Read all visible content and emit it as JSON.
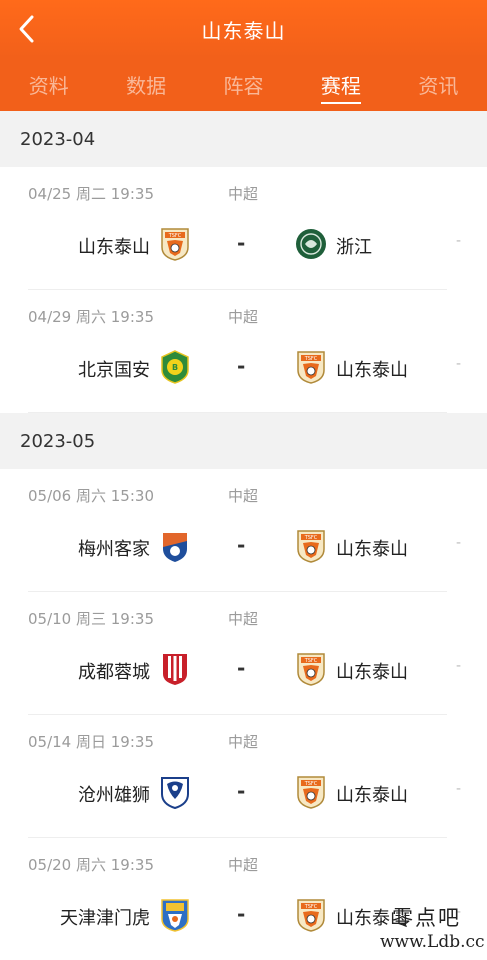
{
  "header": {
    "title": "山东泰山"
  },
  "tabs": [
    {
      "label": "资料",
      "active": false
    },
    {
      "label": "数据",
      "active": false
    },
    {
      "label": "阵容",
      "active": false
    },
    {
      "label": "赛程",
      "active": true
    },
    {
      "label": "资讯",
      "active": false
    }
  ],
  "months": [
    {
      "label": "2023-04",
      "matches": [
        {
          "date": "04/25 周二 19:35",
          "league": "中超",
          "home": "山东泰山",
          "home_logo": "taishan-crest-icon",
          "score": "-",
          "away": "浙江",
          "away_logo": "zhejiang-crest-icon",
          "trail": "-"
        },
        {
          "date": "04/29 周六 19:35",
          "league": "中超",
          "home": "北京国安",
          "home_logo": "guoan-crest-icon",
          "score": "-",
          "away": "山东泰山",
          "away_logo": "taishan-crest-icon",
          "trail": "-"
        }
      ]
    },
    {
      "label": "2023-05",
      "matches": [
        {
          "date": "05/06 周六 15:30",
          "league": "中超",
          "home": "梅州客家",
          "home_logo": "meizhou-crest-icon",
          "score": "-",
          "away": "山东泰山",
          "away_logo": "taishan-crest-icon",
          "trail": "-"
        },
        {
          "date": "05/10 周三 19:35",
          "league": "中超",
          "home": "成都蓉城",
          "home_logo": "chengdu-crest-icon",
          "score": "-",
          "away": "山东泰山",
          "away_logo": "taishan-crest-icon",
          "trail": "-"
        },
        {
          "date": "05/14 周日 19:35",
          "league": "中超",
          "home": "沧州雄狮",
          "home_logo": "cangzhou-crest-icon",
          "score": "-",
          "away": "山东泰山",
          "away_logo": "taishan-crest-icon",
          "trail": "-"
        },
        {
          "date": "05/20 周六 19:35",
          "league": "中超",
          "home": "天津津门虎",
          "home_logo": "tianjin-crest-icon",
          "score": "-",
          "away": "山东泰山",
          "away_logo": "taishan-crest-icon",
          "trail": "-"
        }
      ]
    }
  ],
  "watermark": {
    "top": "零点吧",
    "bottom": "www.Ldb.cc"
  },
  "colors": {
    "accent": "#f2601a",
    "month_bg": "#f2f2f2",
    "muted_text": "#9b9b9b"
  }
}
